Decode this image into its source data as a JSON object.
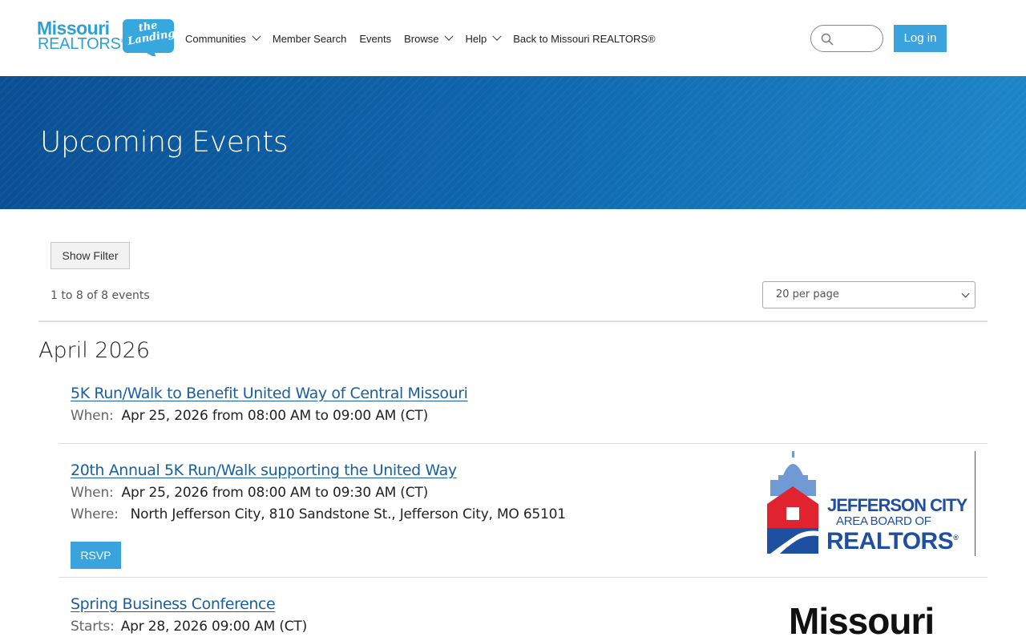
{
  "logo": {
    "line1": "Missouri",
    "line2": "REALTORS",
    "reg": "®",
    "bubble": "the Landing"
  },
  "nav": {
    "items": [
      {
        "label": "Communities",
        "dropdown": true
      },
      {
        "label": "Member Search",
        "dropdown": false
      },
      {
        "label": "Events",
        "dropdown": false
      },
      {
        "label": "Browse",
        "dropdown": true
      },
      {
        "label": "Help",
        "dropdown": true
      },
      {
        "label": "Back to Missouri REALTORS®",
        "dropdown": false
      }
    ],
    "login": "Log in"
  },
  "banner": {
    "title": "Upcoming Events"
  },
  "controls": {
    "show_filter": "Show Filter",
    "count": "1 to 8 of 8 events",
    "per_page": "20 per page"
  },
  "month": "April 2026",
  "events": [
    {
      "title": "5K Run/Walk to Benefit United Way of Central Missouri",
      "when_label": "When:",
      "when": "Apr 25, 2026 from 08:00 AM to 09:00 AM (CT)"
    },
    {
      "title": "20th Annual 5K Run/Walk supporting the United Way",
      "when_label": "When:",
      "when": "Apr 25, 2026 from 08:00 AM to 09:30 AM (CT)",
      "where_label": "Where:",
      "where": "North Jefferson City, 810 Sandstone St., Jefferson City, MO 65101",
      "rsvp": "RSVP",
      "logo": {
        "line1": "JEFFERSON CITY",
        "line2": "AREA BOARD OF",
        "line3": "REALTORS",
        "reg": "®"
      }
    },
    {
      "title": "Spring Business Conference",
      "starts_label": "Starts:",
      "starts": "Apr 28, 2026 09:00 AM (CT)",
      "logo": {
        "line1": "Missouri"
      }
    }
  ],
  "colors": {
    "accent": "#3aa3dd",
    "link": "#1a5f9e",
    "banner": "#0e64ab",
    "jc_blue": "#1f4fa0",
    "jc_red": "#e0232f"
  }
}
